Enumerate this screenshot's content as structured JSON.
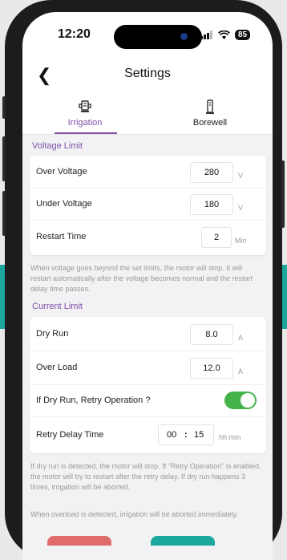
{
  "status_bar": {
    "time": "12:20",
    "battery": "85"
  },
  "header": {
    "title": "Settings",
    "back_icon": "chevron-left-icon"
  },
  "tabs": [
    {
      "label": "Irrigation",
      "icon": "irrigation-pump-icon",
      "active": true
    },
    {
      "label": "Borewell",
      "icon": "borewell-icon",
      "active": false
    }
  ],
  "voltage_limit": {
    "heading": "Voltage Limit",
    "rows": [
      {
        "label": "Over Voltage",
        "value": "280",
        "unit": "V"
      },
      {
        "label": "Under Voltage",
        "value": "180",
        "unit": "V"
      },
      {
        "label": "Restart Time",
        "value": "2",
        "unit": "Min"
      }
    ],
    "note": "When voltage goes beyond the set limits, the motor will stop. It will restart automatically after the voltage becomes normal and the restart delay time passes."
  },
  "current_limit": {
    "heading": "Current Limit",
    "rows": [
      {
        "label": "Dry Run",
        "value": "8.0",
        "unit": "A"
      },
      {
        "label": "Over Load",
        "value": "12.0",
        "unit": "A"
      }
    ],
    "retry_toggle": {
      "label": "If Dry Run, Retry Operation ?",
      "on": true
    },
    "retry_delay": {
      "label": "Retry Delay Time",
      "hours": "00",
      "separator": ":",
      "minutes": "15",
      "unit": "hh:mm"
    },
    "note1": "If dry run is detected, the motor will stop. If \"Retry Operation\" is enabled, the motor will try to restart after the retry delay. If dry run happens 3 times, irrigation will be aborted.",
    "note2": "When overload is detected, irrigation will be aborted immediately."
  },
  "colors": {
    "accent": "#7e4fa8",
    "toggle_on": "#43b34a",
    "teal": "#1ba79b",
    "red": "#e06b6b"
  }
}
